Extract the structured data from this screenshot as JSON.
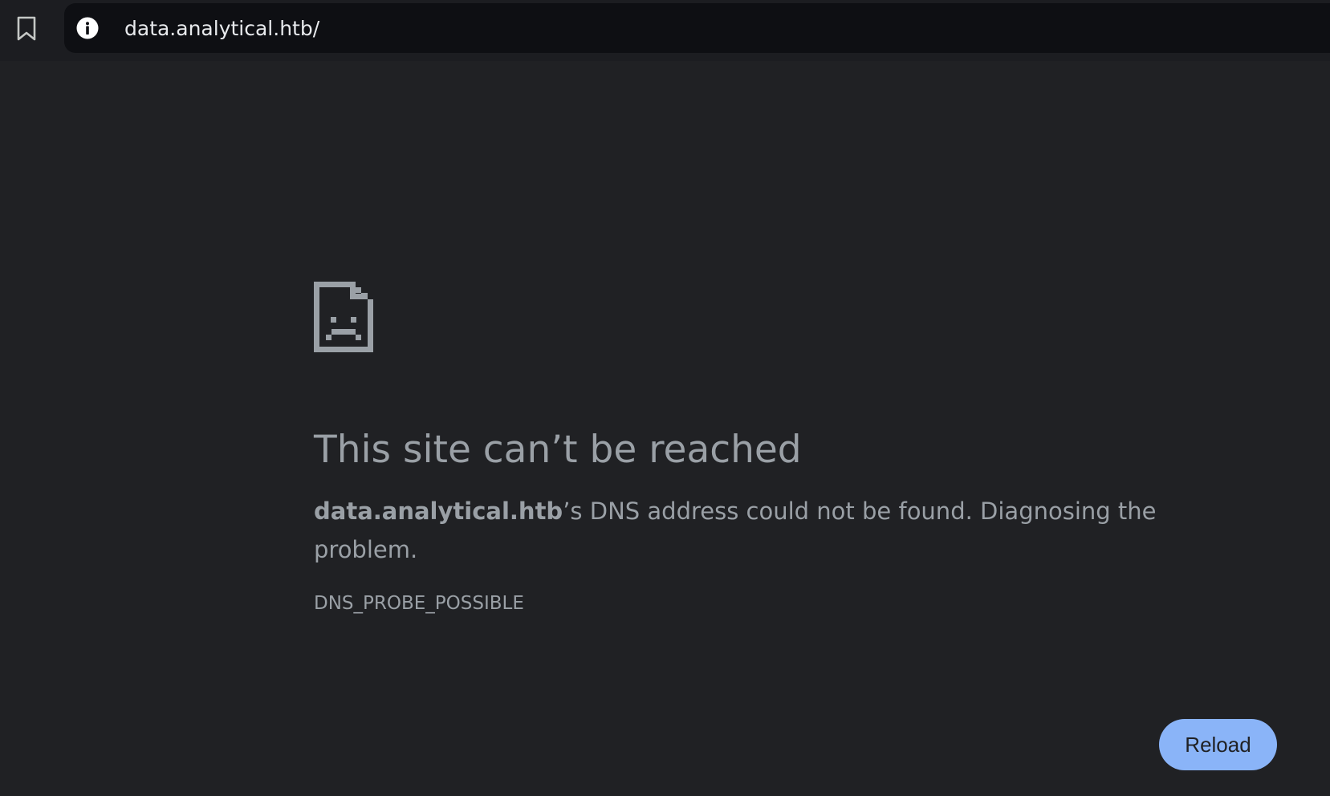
{
  "toolbar": {
    "bookmark_icon": "bookmark-icon",
    "site_info_icon": "info-icon",
    "url": "data.analytical.htb/"
  },
  "error": {
    "icon": "sad-page-icon",
    "title": "This site can’t be reached",
    "host": "data.analytical.htb",
    "message": "’s DNS address could not be found. Diagnosing the problem.",
    "code": "DNS_PROBE_POSSIBLE"
  },
  "actions": {
    "reload_label": "Reload"
  },
  "colors": {
    "page_background": "#202124",
    "text": "#9aa0a6",
    "button": "#8ab4f8"
  }
}
